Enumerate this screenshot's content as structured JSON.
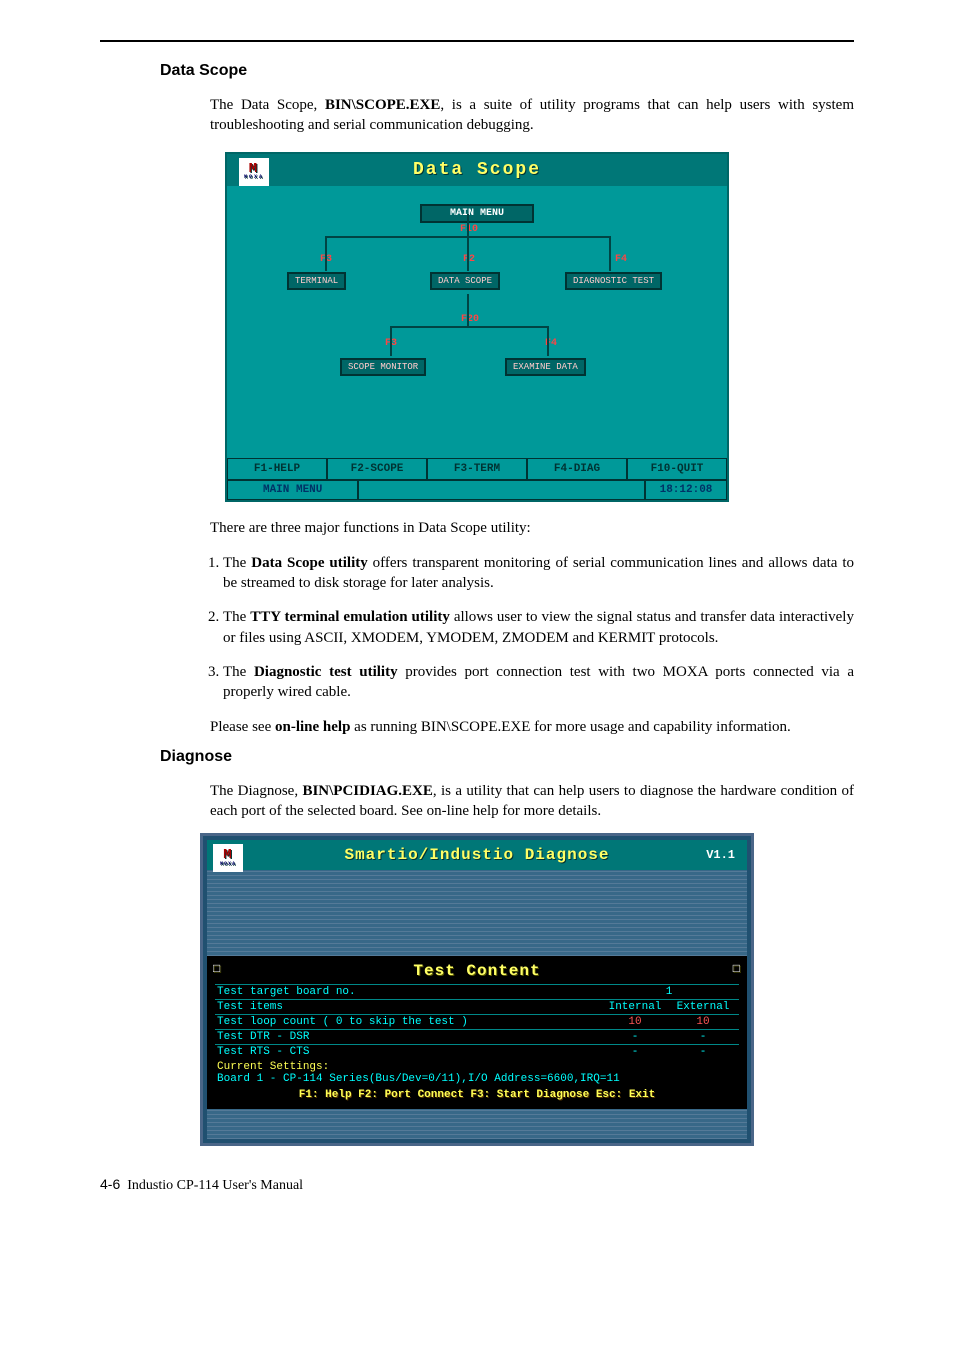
{
  "sections": {
    "data_scope": {
      "heading": "Data Scope",
      "intro_pre": "The Data Scope, ",
      "intro_bold": "BIN\\SCOPE.EXE",
      "intro_post": ", is a suite of utility programs that can help users with system troubleshooting and serial communication debugging.",
      "after_shot": "There are three major functions in Data Scope utility:",
      "items": [
        {
          "pre": "The ",
          "bold": "Data Scope utility",
          "post": " offers transparent monitoring of serial communication lines and allows data to be streamed to disk storage for later analysis."
        },
        {
          "pre": "The ",
          "bold": "TTY terminal emulation utility",
          "post": " allows user to view the signal status and transfer data interactively or files using ASCII, XMODEM, YMODEM, ZMODEM and KERMIT protocols."
        },
        {
          "pre": "The ",
          "bold": "Diagnostic test utility",
          "post": " provides port connection test with two MOXA ports connected via a properly wired cable."
        }
      ],
      "help_pre": "Please see ",
      "help_bold": "on-line help",
      "help_post": " as running BIN\\SCOPE.EXE for more usage and capability information."
    },
    "diagnose": {
      "heading": "Diagnose",
      "intro_pre": "The Diagnose, ",
      "intro_bold": "BIN\\PCIDIAG.EXE",
      "intro_post": ", is a utility that can help users to diagnose the hardware condition of each port of the selected board. See on-line help for more details."
    }
  },
  "ds_shot": {
    "title": "Data Scope",
    "logo_big": "M",
    "logo_small": "MOXA",
    "main_menu": "MAIN MENU",
    "nodes": {
      "terminal": "TERMINAL",
      "data_scope": "DATA SCOPE",
      "diag_test": "DIAGNOSTIC TEST",
      "scope_monitor": "SCOPE MONITOR",
      "examine_data": "EXAMINE DATA"
    },
    "flabels": {
      "f10": "F10",
      "f20": "F20",
      "f2": "F2",
      "f3": "F3",
      "f4": "F4"
    },
    "buttons": [
      "F1-HELP",
      "F2-SCOPE",
      "F3-TERM",
      "F4-DIAG",
      "F10-QUIT"
    ],
    "status_left": "MAIN MENU",
    "status_time": "18:12:08"
  },
  "diag_shot": {
    "title": "Smartio/Industio Diagnose",
    "version": "V1.1",
    "panel_title": "Test Content",
    "rows": [
      {
        "label": "Test target board no.",
        "c1": "",
        "c2": "1",
        "single": true
      },
      {
        "label": "Test items",
        "c1": "Internal",
        "c2": "External"
      },
      {
        "label": "Test loop count ( 0 to skip the test )",
        "c1": "10",
        "c2": "10",
        "red": true
      },
      {
        "label": "Test DTR - DSR",
        "c1": "-",
        "c2": "-"
      },
      {
        "label": "Test RTS - CTS",
        "c1": "-",
        "c2": "-"
      }
    ],
    "current_settings": "Current Settings:",
    "board_line": "Board 1 - CP-114 Series(Bus/Dev=0/11),I/O Address=6600,IRQ=11",
    "help_line": "F1: Help  F2: Port Connect  F3: Start Diagnose  Esc: Exit"
  },
  "footer": {
    "page": "4-6",
    "manual": "Industio CP-114 User's Manual"
  }
}
